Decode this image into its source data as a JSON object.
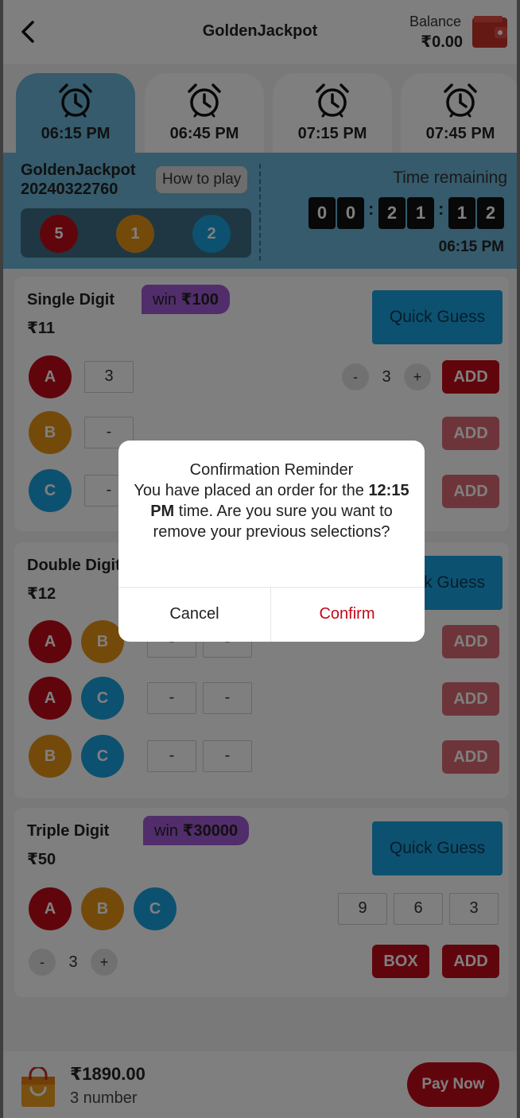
{
  "header": {
    "title": "GoldenJackpot",
    "balance_label": "Balance",
    "balance_value": "₹0.00"
  },
  "tabs": [
    {
      "time": "06:15 PM",
      "active": true
    },
    {
      "time": "06:45 PM",
      "active": false
    },
    {
      "time": "07:15 PM",
      "active": false
    },
    {
      "time": "07:45 PM",
      "active": false
    }
  ],
  "game_info": {
    "name": "GoldenJackpot",
    "period": "20240322760",
    "how_to_play": "How to play",
    "results": [
      "5",
      "1",
      "2"
    ],
    "time_remaining_label": "Time remaining",
    "countdown": [
      "0",
      "0",
      "2",
      "1",
      "1",
      "2"
    ],
    "draw_time": "06:15 PM"
  },
  "single_digit": {
    "title": "Single Digit",
    "win_prefix": "win ",
    "win_amount": "₹100",
    "price": "₹11",
    "quick_guess": "Quick Guess",
    "rows": [
      {
        "ball": "A",
        "value": "3"
      },
      {
        "ball": "B",
        "value": "-"
      },
      {
        "ball": "C",
        "value": "-"
      }
    ],
    "stepper": {
      "minus": "-",
      "value": "3",
      "plus": "+"
    },
    "add_label": "ADD"
  },
  "double_digit": {
    "title": "Double Digit",
    "price": "₹12",
    "quick_guess": "Quick Guess",
    "rows": [
      {
        "balls": [
          "A",
          "B"
        ],
        "values": [
          "-",
          "-"
        ]
      },
      {
        "balls": [
          "A",
          "C"
        ],
        "values": [
          "-",
          "-"
        ]
      },
      {
        "balls": [
          "B",
          "C"
        ],
        "values": [
          "-",
          "-"
        ]
      }
    ],
    "add_label": "ADD"
  },
  "triple_digit": {
    "title": "Triple Digit",
    "win_prefix": "win ",
    "win_amount": "₹30000",
    "price": "₹50",
    "quick_guess": "Quick Guess",
    "balls": [
      "A",
      "B",
      "C"
    ],
    "values": [
      "9",
      "6",
      "3"
    ],
    "stepper": {
      "minus": "-",
      "value": "3",
      "plus": "+"
    },
    "box_label": "BOX",
    "add_label": "ADD"
  },
  "bottom_bar": {
    "total": "₹1890.00",
    "count": "3 number",
    "pay_label": "Pay Now"
  },
  "dialog": {
    "title": "Confirmation Reminder",
    "line_pre": "You have placed an order for the",
    "time_bold": "12:15 PM",
    "line_post": " time. Are you sure you want to remove your previous selections?",
    "cancel": "Cancel",
    "confirm": "Confirm"
  },
  "colors": {
    "red": "#c20a18",
    "orange": "#e99516",
    "blue": "#1aa3e0",
    "tab_active": "#6bb7d8",
    "purple": "#a25ad6"
  }
}
